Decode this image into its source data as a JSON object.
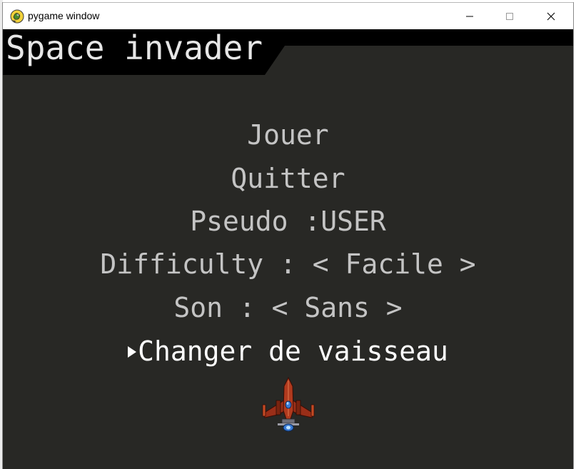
{
  "window": {
    "title": "pygame window",
    "icon": "pygame-snake-icon",
    "controls": [
      "minimize-icon",
      "maximize-icon",
      "close-icon"
    ]
  },
  "game": {
    "title": "Space invader",
    "menu": [
      {
        "label": "Jouer",
        "selected": false
      },
      {
        "label": "Quitter",
        "selected": false
      },
      {
        "label": "Pseudo :USER",
        "selected": false
      },
      {
        "label": "Difficulty : < Facile >",
        "selected": false
      },
      {
        "label": "Son : < Sans >",
        "selected": false
      },
      {
        "label": "Changer de vaisseau",
        "selected": true
      }
    ],
    "selection_marker": "triangle-right-icon",
    "ship_preview": "spaceship-icon"
  },
  "colors": {
    "background": "#282825",
    "banner": "#000000",
    "menu_text": "#c4c4c4",
    "menu_selected": "#ffffff",
    "ship_body": "#b03a1e",
    "ship_accent": "#3a7bd5"
  }
}
